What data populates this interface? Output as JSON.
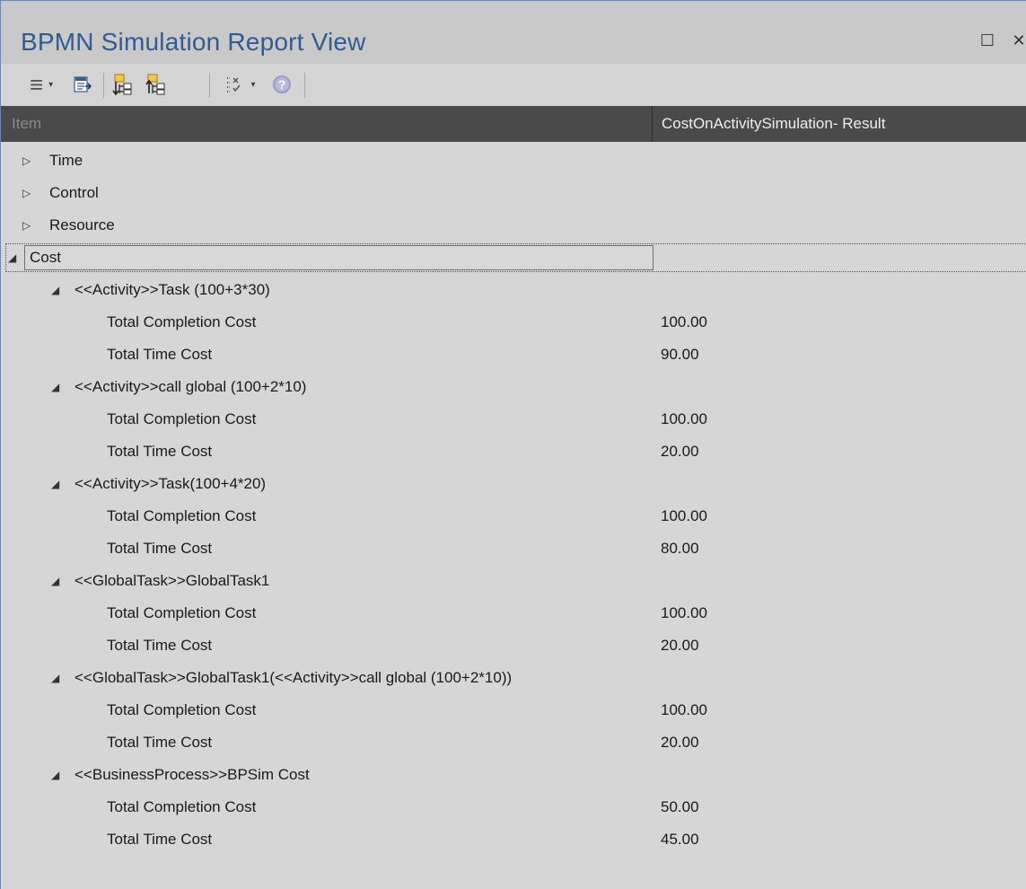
{
  "window": {
    "title": "BPMN Simulation Report View",
    "restore_glyph": "☐",
    "close_glyph": "✕"
  },
  "toolbar": {
    "menu_glyph": "≡",
    "caret": "▾",
    "help_glyph": "?"
  },
  "table": {
    "columns": [
      "Item",
      "CostOnActivitySimulation- Result"
    ],
    "top_level": [
      {
        "label": "Time",
        "expanded": false
      },
      {
        "label": "Control",
        "expanded": false
      },
      {
        "label": "Resource",
        "expanded": false
      },
      {
        "label": "Cost",
        "expanded": true,
        "selected": true
      }
    ],
    "cost_groups": [
      {
        "label": "<<Activity>>Task (100+3*30)",
        "items": [
          {
            "label": "Total Completion Cost",
            "value": "100.00"
          },
          {
            "label": "Total Time Cost",
            "value": "90.00"
          }
        ]
      },
      {
        "label": "<<Activity>>call global (100+2*10)",
        "items": [
          {
            "label": "Total Completion Cost",
            "value": "100.00"
          },
          {
            "label": "Total Time Cost",
            "value": "20.00"
          }
        ]
      },
      {
        "label": "<<Activity>>Task(100+4*20)",
        "items": [
          {
            "label": "Total Completion Cost",
            "value": "100.00"
          },
          {
            "label": "Total Time Cost",
            "value": "80.00"
          }
        ]
      },
      {
        "label": "<<GlobalTask>>GlobalTask1",
        "items": [
          {
            "label": "Total Completion Cost",
            "value": "100.00"
          },
          {
            "label": "Total Time Cost",
            "value": "20.00"
          }
        ]
      },
      {
        "label": "<<GlobalTask>>GlobalTask1(<<Activity>>call global (100+2*10))",
        "items": [
          {
            "label": "Total Completion Cost",
            "value": "100.00"
          },
          {
            "label": "Total Time Cost",
            "value": "20.00"
          }
        ]
      },
      {
        "label": "<<BusinessProcess>>BPSim Cost",
        "items": [
          {
            "label": "Total Completion Cost",
            "value": "50.00"
          },
          {
            "label": "Total Time Cost",
            "value": "45.00"
          }
        ]
      }
    ]
  },
  "colors": {
    "title": "#2f5c95",
    "header_bg": "#4a4a4a",
    "panel_bg": "#d6d6d6"
  }
}
